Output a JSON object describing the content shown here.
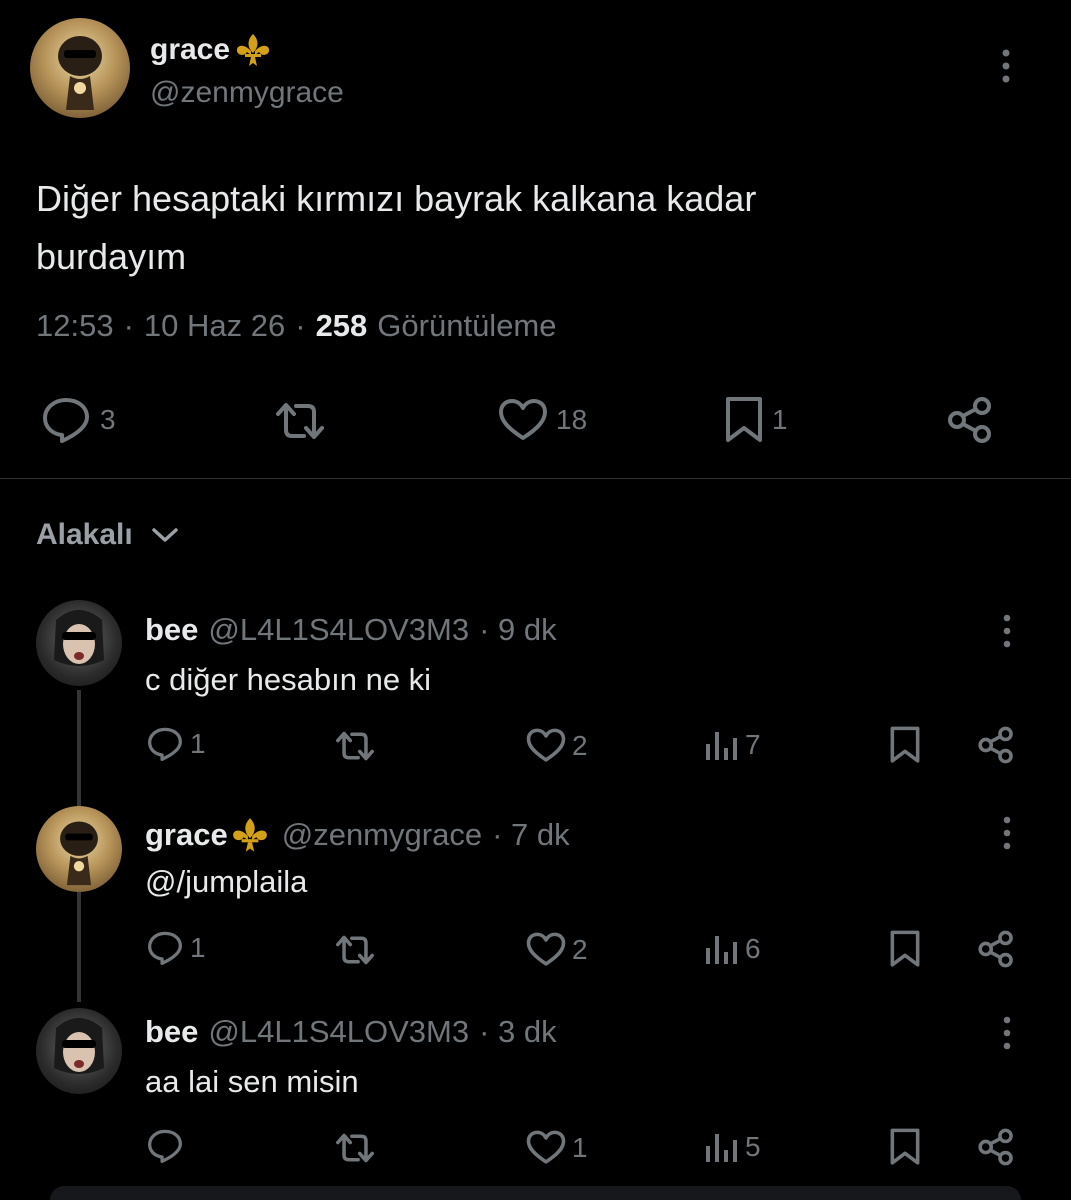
{
  "main_tweet": {
    "author_name": "grace",
    "handle": "@zenmygrace",
    "text_line1": "Diğer hesaptaki kırmızı bayrak kalkana kadar",
    "text_line2": "burdayım",
    "time": "12:53",
    "date": "10 Haz 26",
    "views_count": "258",
    "views_label": "Görüntüleme",
    "sep": "·",
    "replies": "3",
    "likes": "18",
    "bookmarks": "1"
  },
  "section": {
    "label": "Alakalı"
  },
  "replies": [
    {
      "name": "bee",
      "handle": "@L4L1S4LOV3M3",
      "time": "· 9 dk",
      "text": "c diğer hesabın ne ki",
      "replies": "1",
      "likes": "2",
      "views": "7"
    },
    {
      "name": "grace",
      "handle": "@zenmygrace",
      "time": "· 7 dk",
      "text": "@/jumplaila",
      "replies": "1",
      "likes": "2",
      "views": "6"
    },
    {
      "name": "bee",
      "handle": "@L4L1S4LOV3M3",
      "time": "· 3 dk",
      "text": "aa lai sen misin",
      "replies": "",
      "likes": "1",
      "views": "5"
    }
  ],
  "colors": {
    "background": "#000000",
    "text": "#e7e9ea",
    "muted": "#71767b",
    "emoji_gold": "#d4a017"
  },
  "icons": [
    "more-icon",
    "reply-icon",
    "retweet-icon",
    "like-icon",
    "bookmark-icon",
    "share-icon",
    "views-icon",
    "chevron-down-icon",
    "fleur-de-lis-icon"
  ]
}
